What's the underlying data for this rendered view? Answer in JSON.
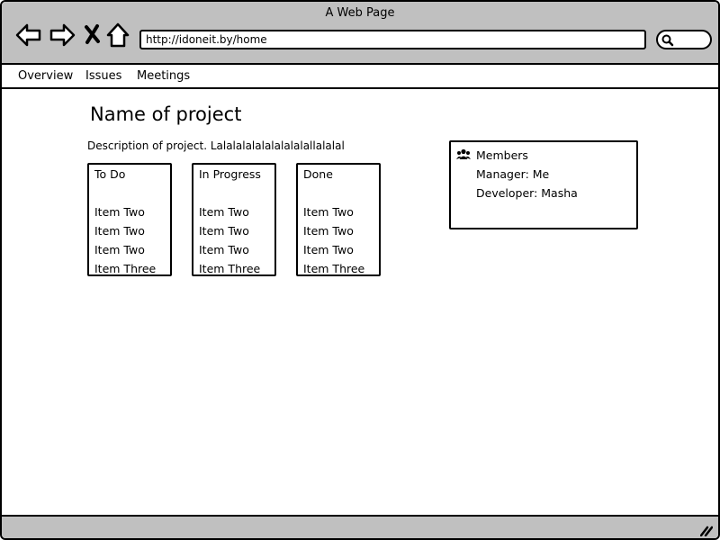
{
  "window": {
    "title": "A Web Page"
  },
  "browser": {
    "url": "http://idoneit.by/home",
    "buttons": [
      {
        "name": "back-button",
        "icon": "back-arrow-icon"
      },
      {
        "name": "forward-button",
        "icon": "forward-arrow-icon"
      },
      {
        "name": "stop-button",
        "icon": "close-icon"
      },
      {
        "name": "home-button",
        "icon": "home-icon"
      }
    ],
    "search_icon": "search-icon"
  },
  "nav": {
    "items": [
      "Overview",
      "Issues",
      "Meetings"
    ]
  },
  "project": {
    "title": "Name of project",
    "description": "Description of project. Lalalalalalalalalalallalalal"
  },
  "board": {
    "columns": [
      {
        "title": "To Do",
        "items": [
          "Item Two",
          "Item Two",
          "Item Two",
          "Item Three"
        ]
      },
      {
        "title": "In Progress",
        "items": [
          "Item Two",
          "Item Two",
          "Item Two",
          "Item Three"
        ]
      },
      {
        "title": "Done",
        "items": [
          "Item Two",
          "Item Two",
          "Item Two",
          "Item Three"
        ]
      }
    ]
  },
  "members": {
    "title": "Members",
    "icon": "users-icon",
    "lines": [
      "Manager: Me",
      "Developer: Masha"
    ]
  }
}
